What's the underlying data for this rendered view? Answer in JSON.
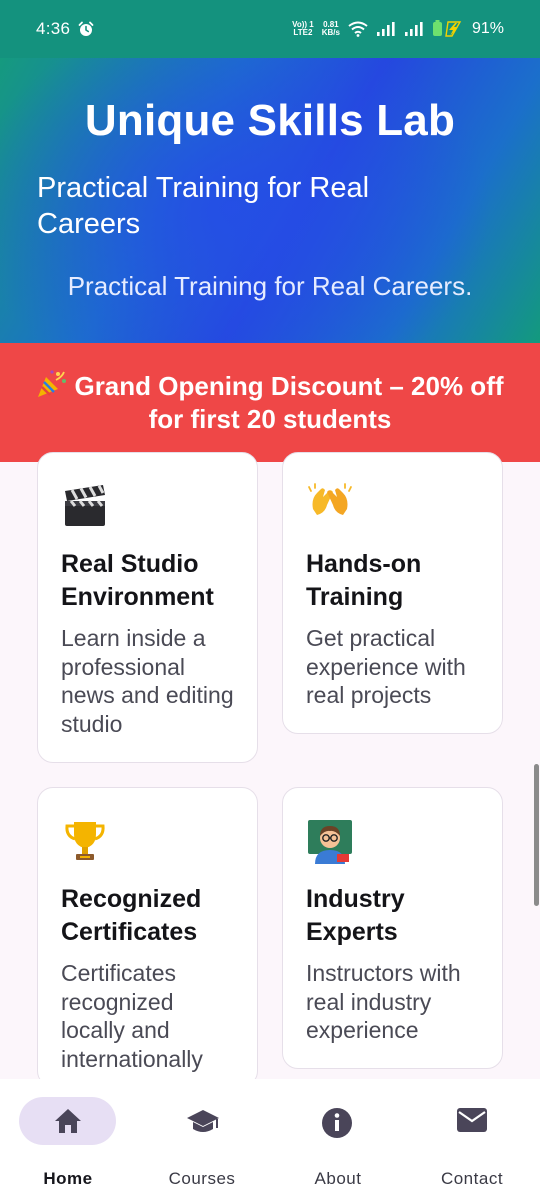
{
  "status_bar": {
    "time": "4:36",
    "network_top": "Vo)) 1",
    "network_bottom": "LTE2",
    "speed_top": "0.81",
    "speed_bottom": "KB/s",
    "battery": "91%",
    "icons": [
      "alarm-icon",
      "wifi-icon",
      "signal-icon",
      "signal-icon",
      "battery-charging-icon"
    ]
  },
  "hero": {
    "title": "Unique Skills Lab",
    "subtitle": "Practical Training for Real Careers",
    "tagline": "Practical Training for Real Careers."
  },
  "promo": {
    "icon": "party-popper-icon",
    "text": "Grand Opening Discount – 20% off for first 20 students"
  },
  "features": [
    {
      "icon": "clapper-board-icon",
      "title": "Real Studio Environment",
      "description": "Learn inside a professional news and editing studio"
    },
    {
      "icon": "clapping-hands-icon",
      "title": "Hands-on Training",
      "description": "Get practical experience with real projects"
    },
    {
      "icon": "trophy-icon",
      "title": "Recognized Certificates",
      "description": "Certificates recognized locally and internationally"
    },
    {
      "icon": "teacher-icon",
      "title": "Industry Experts",
      "description": "Instructors with real industry experience"
    }
  ],
  "bottom_nav": {
    "active": "Home",
    "items": [
      {
        "label": "Home",
        "icon": "home-icon"
      },
      {
        "label": "Courses",
        "icon": "graduation-cap-icon"
      },
      {
        "label": "About",
        "icon": "info-icon"
      },
      {
        "label": "Contact",
        "icon": "mail-icon"
      }
    ]
  },
  "colors": {
    "status_bar": "#14927e",
    "promo": "#ef4747",
    "nav_active_pill": "#e7dff4",
    "background": "#fcf6fb"
  }
}
